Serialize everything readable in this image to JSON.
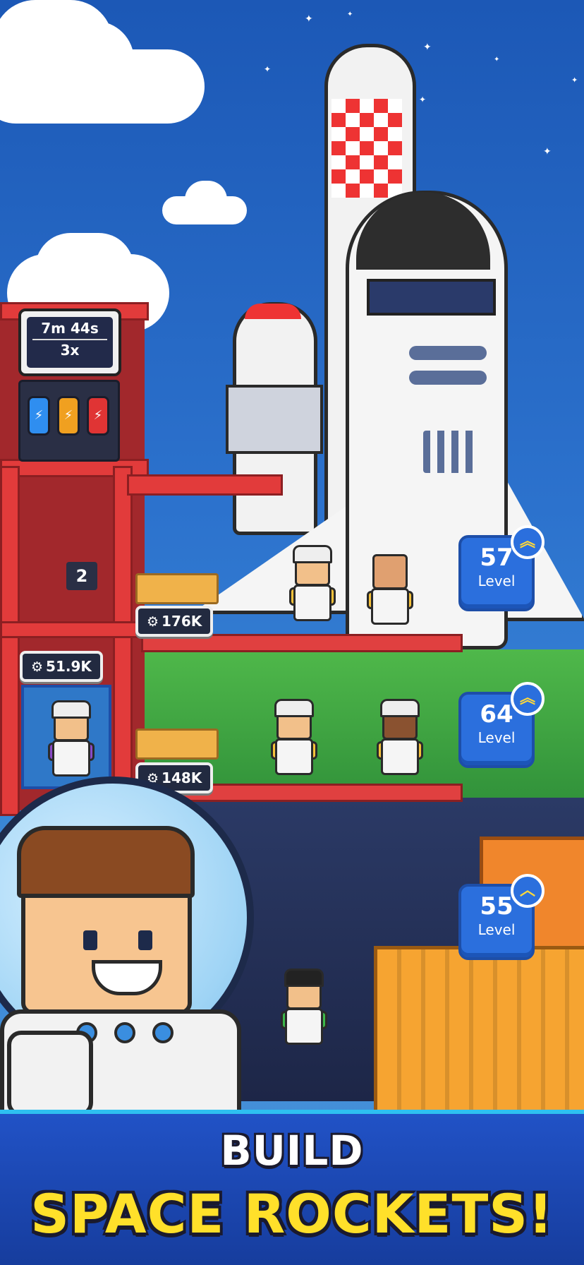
{
  "tower": {
    "timer": "7m 44s",
    "multiplier": "3x",
    "floor_number": "2",
    "battery_colors": [
      "#2f8ef0",
      "#f0a020",
      "#e03434"
    ],
    "resource_tag": "51.9K"
  },
  "platforms": [
    {
      "resource": "176K"
    },
    {
      "resource": "148K"
    }
  ],
  "levels": [
    {
      "value": "57",
      "label": "Level",
      "upgrade_icon": "double-chevron-up-icon"
    },
    {
      "value": "64",
      "label": "Level",
      "upgrade_icon": "double-chevron-up-icon"
    },
    {
      "value": "55",
      "label": "Level",
      "upgrade_icon": "chevron-up-icon"
    }
  ],
  "banner": {
    "line1": "BUILD",
    "line2": "SPACE ROCKETS!"
  },
  "colors": {
    "sky": "#2c72cd",
    "tower_red": "#e23b3b",
    "level_badge": "#2b6fdd",
    "banner_text": "#ffe02a"
  }
}
